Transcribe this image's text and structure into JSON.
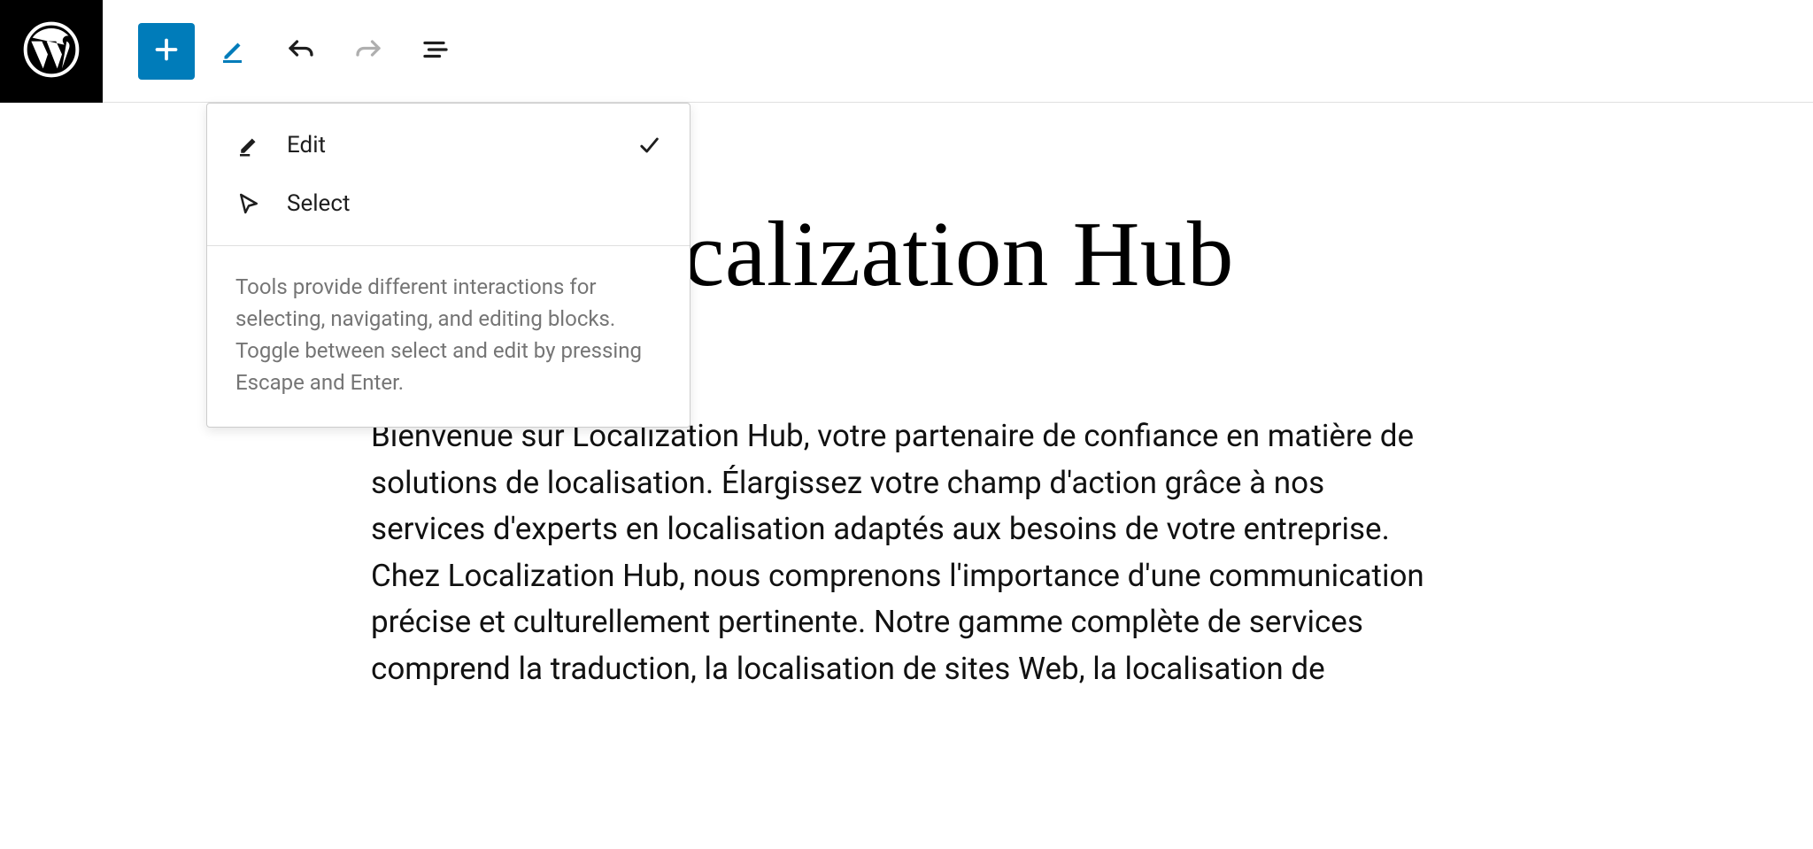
{
  "toolbar": {
    "add_label": "Add block",
    "tools_label": "Tools",
    "undo_label": "Undo",
    "redo_label": "Redo",
    "outline_label": "Document outline"
  },
  "tools_menu": {
    "items": [
      {
        "label": "Edit",
        "selected": true
      },
      {
        "label": "Select",
        "selected": false
      }
    ],
    "help_text": "Tools provide different interactions for selecting, navigating, and editing blocks. Toggle between select and edit by pressing Escape and Enter."
  },
  "page": {
    "title": "Localization Hub",
    "body": "Bienvenue sur Localization Hub, votre partenaire de confiance en matière de solutions de localisation. Élargissez votre champ d'action grâce à nos services d'experts en localisation adaptés aux besoins de votre entreprise. Chez Localization Hub, nous comprenons l'importance d'une communication précise et culturellement pertinente. Notre gamme complète de services comprend la traduction, la localisation de sites Web, la localisation de"
  }
}
